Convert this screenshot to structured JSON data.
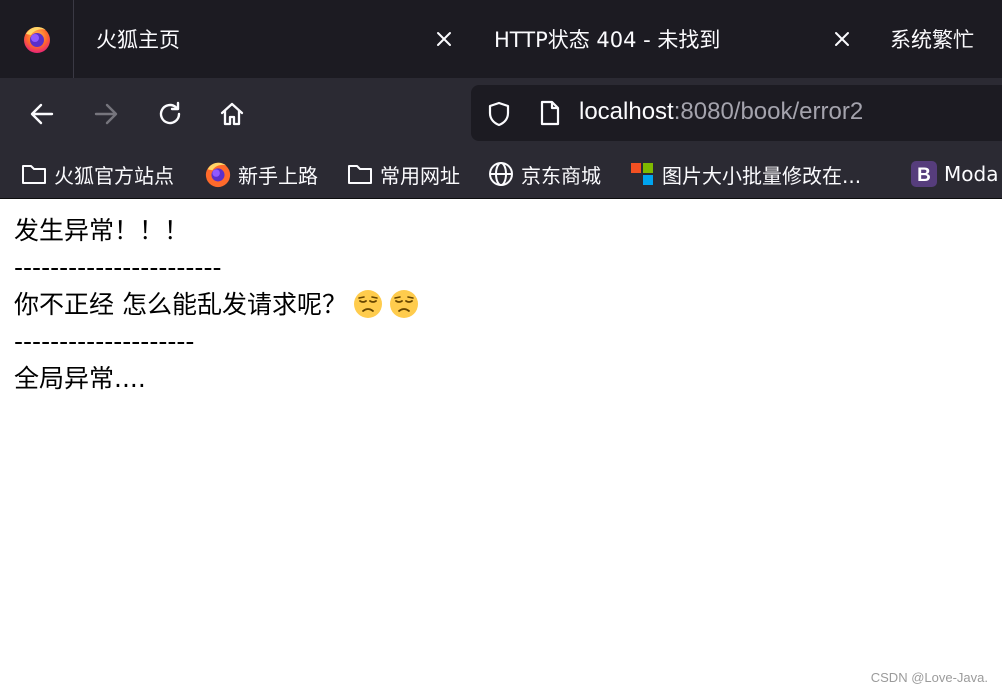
{
  "tabs": [
    {
      "title": "火狐主页"
    },
    {
      "title": "HTTP状态 404 - 未找到"
    },
    {
      "title": "系统繁忙"
    }
  ],
  "urlbar": {
    "host": "localhost",
    "path": ":8080/book/error2"
  },
  "bookmarks": [
    {
      "label": "火狐官方站点",
      "icon": "folder-icon"
    },
    {
      "label": "新手上路",
      "icon": "firefox-icon"
    },
    {
      "label": "常用网址",
      "icon": "folder-icon"
    },
    {
      "label": "京东商城",
      "icon": "globe-icon"
    },
    {
      "label": "图片大小批量修改在...",
      "icon": "color-squares-icon"
    },
    {
      "label": "Moda",
      "icon": "bootstrap-icon"
    }
  ],
  "page": {
    "line1": "发生异常！！！",
    "sep1": "-----------------------",
    "line2": "你不正经 怎么能乱发请求呢？",
    "sep2": "--------------------",
    "line3": "全局异常...."
  },
  "watermark": "CSDN @Love-Java."
}
